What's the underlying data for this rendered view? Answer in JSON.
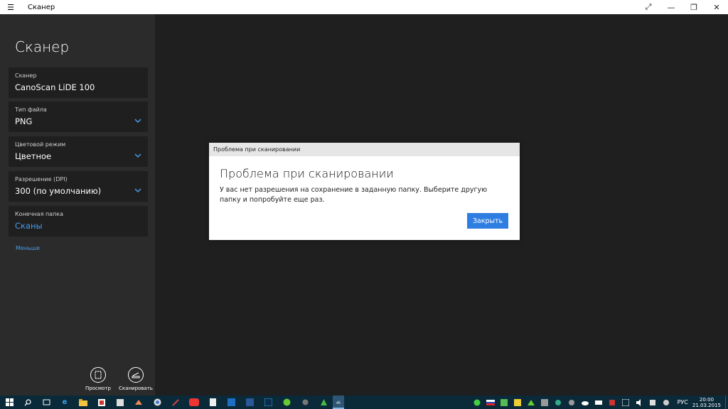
{
  "window": {
    "title": "Сканер"
  },
  "sidebar": {
    "app_title": "Сканер",
    "fields": [
      {
        "label": "Сканер",
        "value": "CanoScan LiDE 100"
      },
      {
        "label": "Тип файла",
        "value": "PNG"
      },
      {
        "label": "Цветовой режим",
        "value": "Цветное"
      },
      {
        "label": "Разрешение (DPI)",
        "value": "300 (по умолчанию)"
      },
      {
        "label": "Конечная папка",
        "value": "Сканы"
      }
    ],
    "less_link": "Меньше",
    "actions": {
      "preview_label": "Просмотр",
      "scan_label": "Сканировать"
    }
  },
  "dialog": {
    "titlebar": "Проблема при сканировании",
    "heading": "Проблема при сканировании",
    "message": "У вас нет разрешения на сохранение в заданную папку. Выберите другую папку и попробуйте еще раз.",
    "close_button": "Закрыть"
  },
  "taskbar": {
    "language": "РУС",
    "time": "20:00",
    "date": "21.03.2015"
  },
  "colors": {
    "accent": "#2e7de1",
    "link": "#4a9be8",
    "sidebar_bg": "#2b2b2b",
    "main_bg": "#1f1f1f",
    "taskbar_bg": "#0a2a3a"
  }
}
